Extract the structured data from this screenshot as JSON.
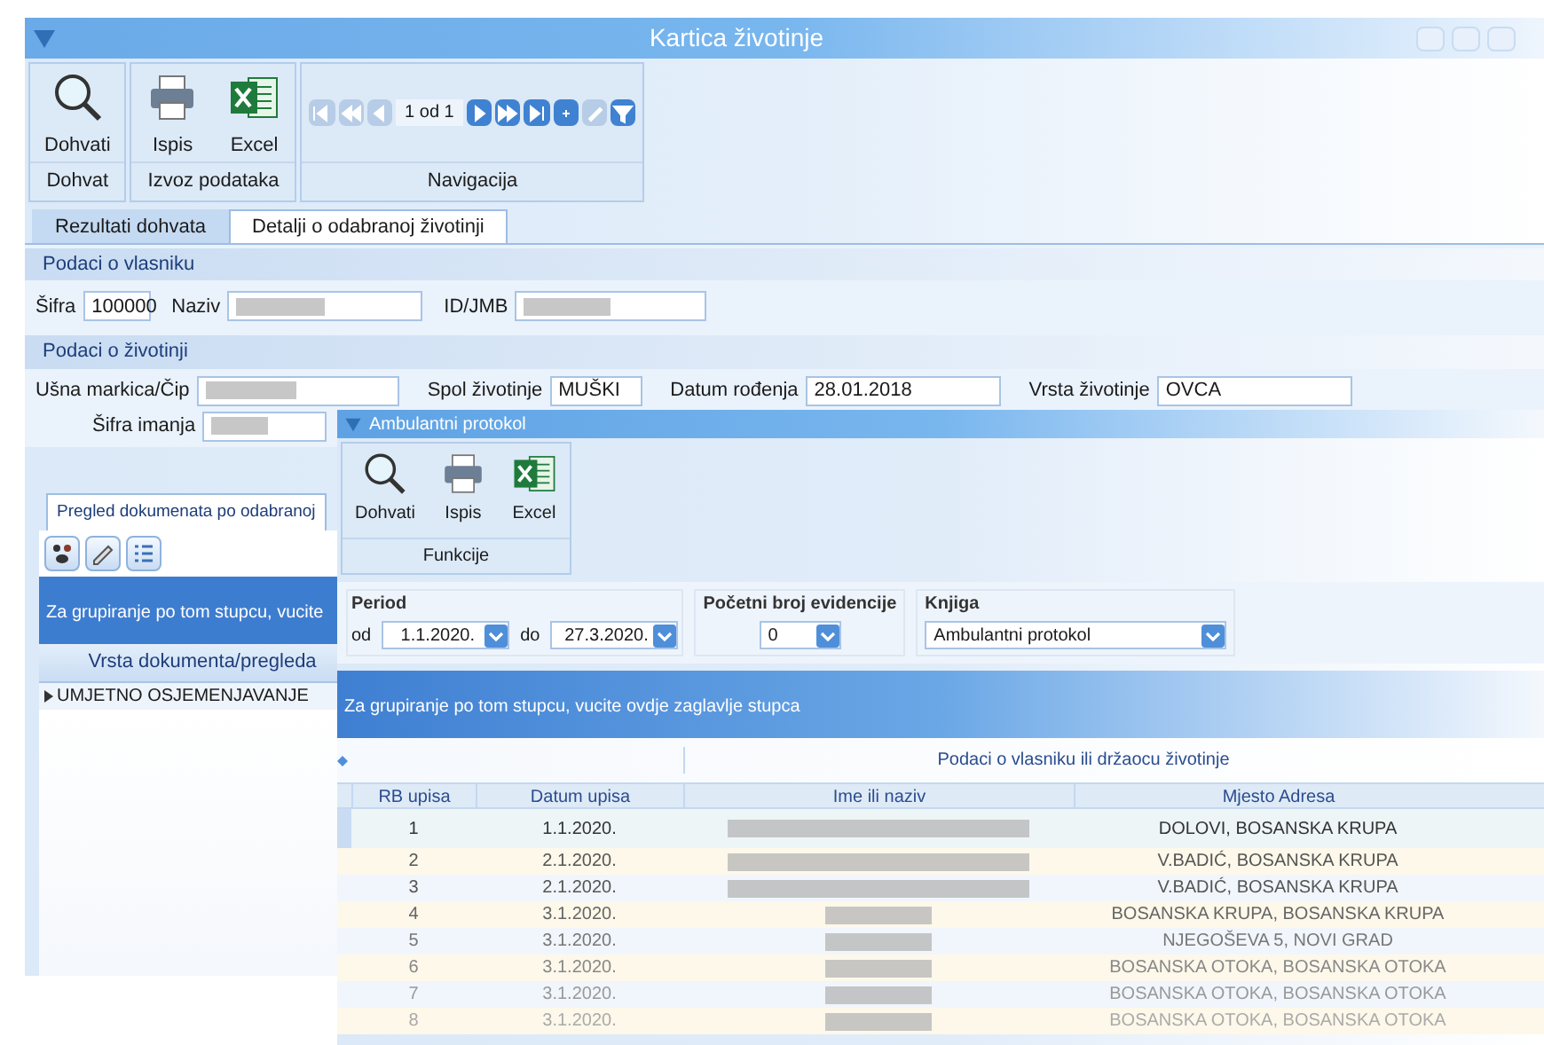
{
  "main_window": {
    "title": "Kartica životinje",
    "ribbon": {
      "groups": [
        {
          "label": "Dohvat",
          "buttons": [
            {
              "kind": "search",
              "label": "Dohvati"
            }
          ]
        },
        {
          "label": "Izvoz podataka",
          "buttons": [
            {
              "kind": "print",
              "label": "Ispis"
            },
            {
              "kind": "excel",
              "label": "Excel"
            }
          ]
        }
      ],
      "navigation": {
        "label": "Navigacija",
        "position": "1 od 1",
        "buttons": [
          {
            "kind": "first",
            "disabled": true
          },
          {
            "kind": "prev_page",
            "disabled": true
          },
          {
            "kind": "prev",
            "disabled": true
          },
          {
            "kind": "next",
            "disabled": false
          },
          {
            "kind": "next_page",
            "disabled": false
          },
          {
            "kind": "last",
            "disabled": false
          },
          {
            "kind": "add",
            "disabled": false
          },
          {
            "kind": "edit",
            "disabled": true
          },
          {
            "kind": "filter",
            "disabled": false
          }
        ]
      }
    },
    "tabs": [
      {
        "label": "Rezultati dohvata",
        "selected": false
      },
      {
        "label": "Detalji o odabranoj životinji",
        "selected": true
      }
    ],
    "owner": {
      "heading": "Podaci o vlasniku",
      "fields": [
        {
          "label": "Šifra",
          "value": "100000",
          "blurred": false
        },
        {
          "label": "Naziv",
          "blurred": true
        },
        {
          "label": "ID/JMB",
          "blurred": true
        }
      ]
    },
    "animal": {
      "heading": "Podaci o životinji",
      "fields": [
        {
          "label": "Ušna markica/Čip",
          "blurred": true
        },
        {
          "label": "Spol životinje",
          "value": "MUŠKI",
          "blurred": false
        },
        {
          "label": "Datum rođenja",
          "value": "28.01.2018",
          "blurred": false
        },
        {
          "label": "Vrsta životinje",
          "value": "OVCA",
          "blurred": false
        }
      ],
      "second_row": {
        "label": "Šifra imanja",
        "blurred": true
      }
    },
    "documents": {
      "tab": "Pregled dokumenata po odabranoj",
      "tools": [
        {
          "kind": "paw"
        },
        {
          "kind": "pen"
        },
        {
          "kind": "list"
        }
      ],
      "group_hint": "Za grupiranje po tom stupcu, vucite",
      "column": "Vrsta dokumenta/pregleda",
      "rows": [
        {
          "text": "UMJETNO OSJEMENJAVANJE",
          "selected": true
        }
      ]
    }
  },
  "protocol_window": {
    "title": "Ambulantni protokol",
    "ribbon": {
      "label": "Funkcije",
      "buttons": [
        {
          "kind": "search",
          "label": "Dohvati"
        },
        {
          "kind": "print",
          "label": "Ispis"
        },
        {
          "kind": "excel",
          "label": "Excel"
        }
      ]
    },
    "period": {
      "label": "Period",
      "from_label": "od",
      "from": "1.1.2020.",
      "to_label": "do",
      "to": "27.3.2020."
    },
    "start_number": {
      "label": "Početni broj evidencije",
      "value": "0"
    },
    "book": {
      "label": "Knjiga",
      "value": "Ambulantni protokol"
    },
    "group_hint": "Za grupiranje po tom stupcu, vucite ovdje zaglavlje stupca",
    "band": "Podaci o vlasniku ili držaocu životinje",
    "columns": [
      "RB upisa",
      "Datum upisa",
      "Ime ili naziv",
      "Mjesto Adresa"
    ],
    "rows": [
      {
        "rb": "1",
        "date": "1.1.2020.",
        "address": "DOLOVI, BOSANSKA KRUPA",
        "selected": true
      },
      {
        "rb": "2",
        "date": "2.1.2020.",
        "address": "V.BADIĆ, BOSANSKA KRUPA",
        "selected": false
      },
      {
        "rb": "3",
        "date": "2.1.2020.",
        "address": "V.BADIĆ, BOSANSKA KRUPA",
        "selected": false
      },
      {
        "rb": "4",
        "date": "3.1.2020.",
        "address": "BOSANSKA KRUPA, BOSANSKA KRUPA",
        "selected": false
      },
      {
        "rb": "5",
        "date": "3.1.2020.",
        "address": "NJEGOŠEVA 5, NOVI GRAD",
        "selected": false
      },
      {
        "rb": "6",
        "date": "3.1.2020.",
        "address": "BOSANSKA OTOKA, BOSANSKA OTOKA",
        "selected": false
      },
      {
        "rb": "7",
        "date": "3.1.2020.",
        "address": "BOSANSKA OTOKA, BOSANSKA OTOKA",
        "selected": false
      },
      {
        "rb": "8",
        "date": "3.1.2020.",
        "address": "BOSANSKA OTOKA, BOSANSKA OTOKA",
        "selected": false
      }
    ]
  }
}
